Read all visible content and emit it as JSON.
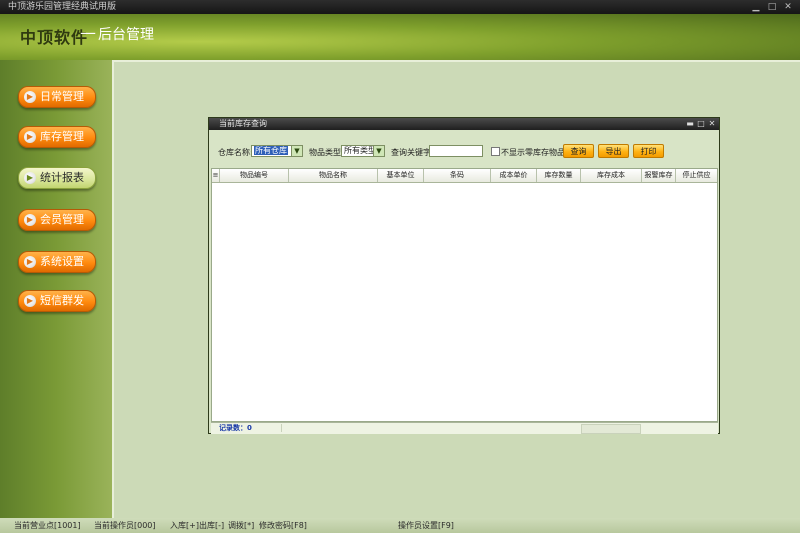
{
  "window": {
    "title": "中顶游乐园管理经典试用版"
  },
  "header": {
    "brand": "中顶软件",
    "dash": "—",
    "subtitle": "后台管理"
  },
  "sidebar": {
    "items": [
      {
        "label": "日常管理",
        "active": false
      },
      {
        "label": "库存管理",
        "active": false
      },
      {
        "label": "统计报表",
        "active": true
      },
      {
        "label": "会员管理",
        "active": false
      },
      {
        "label": "系统设置",
        "active": false
      },
      {
        "label": "短信群发",
        "active": false
      }
    ]
  },
  "dialog": {
    "title": "当前库存查询",
    "filters": {
      "warehouse_label": "仓库名称:",
      "warehouse_value": "所有仓库",
      "category_label": "物品类型:",
      "category_value": "所有类型",
      "keyword_label": "查询关键字:",
      "keyword_value": "",
      "hide_zero_label": "不显示零库存物品",
      "hide_zero_checked": false
    },
    "buttons": {
      "query": "查询",
      "export": "导出",
      "print": "打印"
    },
    "grid": {
      "columns": [
        "物品编号",
        "物品名称",
        "基本单位",
        "条码",
        "成本单价",
        "库存数量",
        "库存成本",
        "报警库存",
        "停止供应"
      ],
      "rows": []
    },
    "status": {
      "records_label": "记录数：0"
    }
  },
  "bottombar": {
    "shop": "当前营业点[1001]",
    "operator": "当前操作员[000]",
    "in": "入库[+]",
    "out": "出库[-]",
    "transfer": "调拨[*]",
    "password": "修改密码[F8]",
    "operator_settings": "操作员设置[F9]"
  },
  "colors": {
    "accent_orange": "#ff8a0e",
    "banner_green": "#7fa02c",
    "content_bg": "#ccdab7"
  }
}
